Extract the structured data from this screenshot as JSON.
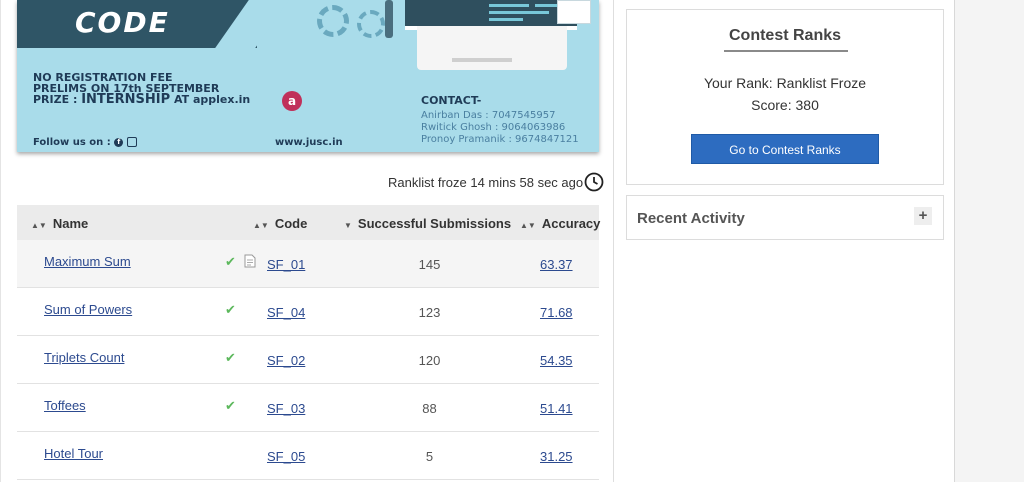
{
  "banner": {
    "code_text": "CODE",
    "info_line1": "NO REGISTRATION FEE",
    "info_line2": "PRELIMS  ON  17th SEPTEMBER",
    "info_line3_prefix": "PRIZE : ",
    "info_line3_bold": "INTERNSHIP",
    "info_line3_suffix": " AT applex.in",
    "applex_logo": "a",
    "follow": "Follow us on :",
    "website": "www.jusc.in",
    "contact_heading": "CONTACT-",
    "contacts": [
      "Anirban Das : 7047545957",
      "Rwitick  Ghosh : 9064063986",
      "Pronoy Pramanik : 9674847121"
    ]
  },
  "ranklist_status": "Ranklist froze 14 mins 58 sec ago",
  "table": {
    "headers": {
      "name": "Name",
      "code": "Code",
      "submissions": "Successful Submissions",
      "accuracy": "Accuracy"
    },
    "rows": [
      {
        "name": "Maximum Sum",
        "solved": true,
        "has_doc": true,
        "code": "SF_01",
        "submissions": "145",
        "accuracy": "63.37"
      },
      {
        "name": "Sum of Powers",
        "solved": true,
        "has_doc": false,
        "code": "SF_04",
        "submissions": "123",
        "accuracy": "71.68"
      },
      {
        "name": "Triplets Count",
        "solved": true,
        "has_doc": false,
        "code": "SF_02",
        "submissions": "120",
        "accuracy": "54.35"
      },
      {
        "name": "Toffees",
        "solved": true,
        "has_doc": false,
        "code": "SF_03",
        "submissions": "88",
        "accuracy": "51.41"
      },
      {
        "name": "Hotel Tour",
        "solved": false,
        "has_doc": false,
        "code": "SF_05",
        "submissions": "5",
        "accuracy": "31.25"
      }
    ]
  },
  "contest_ranks": {
    "title": "Contest Ranks",
    "your_rank": "Your Rank: Ranklist Froze",
    "score": "Score: 380",
    "button": "Go to Contest Ranks"
  },
  "recent_activity": {
    "title": "Recent Activity",
    "expand": "+"
  },
  "colors": {
    "link": "#2c4a8f",
    "check": "#5cb85c",
    "button": "#2d6cc0",
    "banner_bg": "#a9dcea"
  },
  "icons": [
    "clock-icon",
    "check-icon",
    "doc-icon",
    "sort-icon",
    "plus-icon",
    "facebook-icon",
    "instagram-icon"
  ]
}
